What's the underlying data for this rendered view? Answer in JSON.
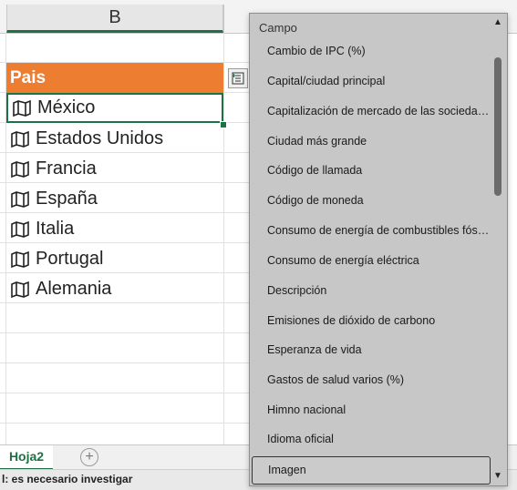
{
  "sheet": {
    "column_label": "B",
    "header_label": "Pais",
    "countries": [
      "México",
      "Estados Unidos",
      "Francia",
      "España",
      "Italia",
      "Portugal",
      "Alemania"
    ],
    "tab_label": "Hoja2",
    "add_sheet_label": "+",
    "status_text": "l: es necesario investigar"
  },
  "dropdown": {
    "title": "Campo",
    "fields": [
      "Cambio de IPC (%)",
      "Capital/ciudad principal",
      "Capitalización de mercado de las sociedades...",
      "Ciudad más grande",
      "Código de llamada",
      "Código de moneda",
      "Consumo de energía de combustibles fósiles...",
      "Consumo de energía eléctrica",
      "Descripción",
      "Emisiones de dióxido de carbono",
      "Esperanza de vida",
      "Gastos de salud varios (%)",
      "Himno nacional",
      "Idioma oficial",
      "Imagen"
    ],
    "highlighted_field": "Imagen",
    "scroll_up_icon": "▲",
    "scroll_down_icon": "▼"
  },
  "colors": {
    "accent_green": "#1e7145",
    "header_orange": "#ed7d31"
  }
}
